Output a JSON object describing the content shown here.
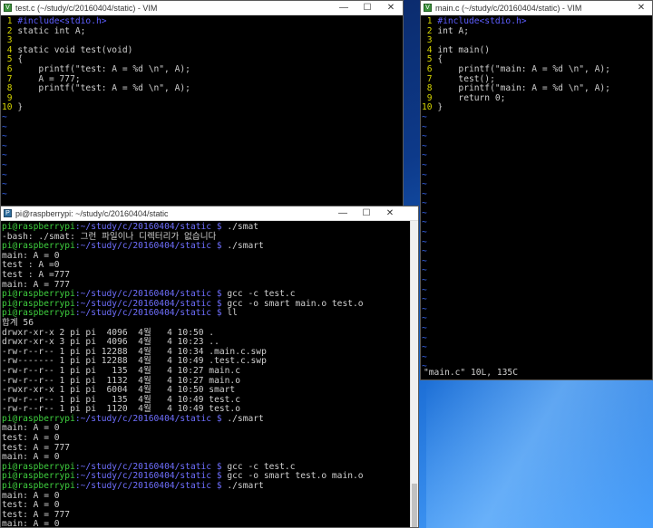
{
  "vim_left": {
    "title": "test.c (~/study/c/20160404/static) - VIM",
    "lines": [
      {
        "n": "1",
        "code": "#include<stdio.h>"
      },
      {
        "n": "2",
        "code": "static int A;"
      },
      {
        "n": "3",
        "code": ""
      },
      {
        "n": "4",
        "code": "static void test(void)"
      },
      {
        "n": "5",
        "code": "{"
      },
      {
        "n": "6",
        "code": "    printf(\"test: A = %d \\n\", A);"
      },
      {
        "n": "7",
        "code": "    A = 777;"
      },
      {
        "n": "8",
        "code": "    printf(\"test: A = %d \\n\", A);"
      },
      {
        "n": "9",
        "code": ""
      },
      {
        "n": "10",
        "code": "}"
      }
    ]
  },
  "vim_right": {
    "title": "main.c (~/study/c/20160404/static) - VIM",
    "lines": [
      {
        "n": "1",
        "code": "#include<stdio.h>"
      },
      {
        "n": "2",
        "code": "int A;"
      },
      {
        "n": "3",
        "code": ""
      },
      {
        "n": "4",
        "code": "int main()"
      },
      {
        "n": "5",
        "code": "{"
      },
      {
        "n": "6",
        "code": "    printf(\"main: A = %d \\n\", A);"
      },
      {
        "n": "7",
        "code": "    test();"
      },
      {
        "n": "8",
        "code": "    printf(\"main: A = %d \\n\", A);"
      },
      {
        "n": "9",
        "code": "    return 0;"
      },
      {
        "n": "10",
        "code": "}"
      }
    ],
    "status": "\"main.c\" 10L, 135C"
  },
  "terminal": {
    "title": "pi@raspberrypi: ~/study/c/20160404/static",
    "prompt_user": "pi@raspberrypi",
    "prompt_path": ":~/study/c/20160404/static $",
    "lines": [
      {
        "type": "prompt",
        "cmd": " ./smat"
      },
      {
        "type": "out",
        "text": "-bash: ./smat: 그런 파일이나 디렉터리가 없습니다"
      },
      {
        "type": "prompt",
        "cmd": " ./smart"
      },
      {
        "type": "out",
        "text": "main: A = 0"
      },
      {
        "type": "out",
        "text": "test : A =0"
      },
      {
        "type": "out",
        "text": "test : A =777"
      },
      {
        "type": "out",
        "text": "main: A = 777"
      },
      {
        "type": "prompt",
        "cmd": " gcc -c test.c"
      },
      {
        "type": "prompt",
        "cmd": " gcc -o smart main.o test.o"
      },
      {
        "type": "prompt",
        "cmd": " ll"
      },
      {
        "type": "out",
        "text": "합계 56"
      },
      {
        "type": "out",
        "text": "drwxr-xr-x 2 pi pi  4096  4월   4 10:50 ."
      },
      {
        "type": "out",
        "text": "drwxr-xr-x 3 pi pi  4096  4월   4 10:23 .."
      },
      {
        "type": "out",
        "text": "-rw-r--r-- 1 pi pi 12288  4월   4 10:34 .main.c.swp"
      },
      {
        "type": "out",
        "text": "-rw------- 1 pi pi 12288  4월   4 10:49 .test.c.swp"
      },
      {
        "type": "out",
        "text": "-rw-r--r-- 1 pi pi   135  4월   4 10:27 main.c"
      },
      {
        "type": "out",
        "text": "-rw-r--r-- 1 pi pi  1132  4월   4 10:27 main.o"
      },
      {
        "type": "out",
        "text": "-rwxr-xr-x 1 pi pi  6004  4월   4 10:50 smart"
      },
      {
        "type": "out",
        "text": "-rw-r--r-- 1 pi pi   135  4월   4 10:49 test.c"
      },
      {
        "type": "out",
        "text": "-rw-r--r-- 1 pi pi  1120  4월   4 10:49 test.o"
      },
      {
        "type": "prompt",
        "cmd": " ./smart"
      },
      {
        "type": "out",
        "text": "main: A = 0"
      },
      {
        "type": "out",
        "text": "test: A = 0"
      },
      {
        "type": "out",
        "text": "test: A = 777"
      },
      {
        "type": "out",
        "text": "main: A = 0"
      },
      {
        "type": "prompt",
        "cmd": " gcc -c test.c"
      },
      {
        "type": "prompt",
        "cmd": " gcc -o smart test.o main.o"
      },
      {
        "type": "prompt",
        "cmd": " ./smart"
      },
      {
        "type": "out",
        "text": "main: A = 0"
      },
      {
        "type": "out",
        "text": "test: A = 0"
      },
      {
        "type": "out",
        "text": "test: A = 777"
      },
      {
        "type": "out",
        "text": "main: A = 0"
      }
    ]
  },
  "window_controls": {
    "minimize": "—",
    "maximize": "☐",
    "close": "✕"
  },
  "colors": {
    "line_number": "#d7d700",
    "tilde": "#3b6cff",
    "string": "#ff5cff",
    "prompt_user": "#3fd13f",
    "prompt_path": "#6f6fff"
  }
}
